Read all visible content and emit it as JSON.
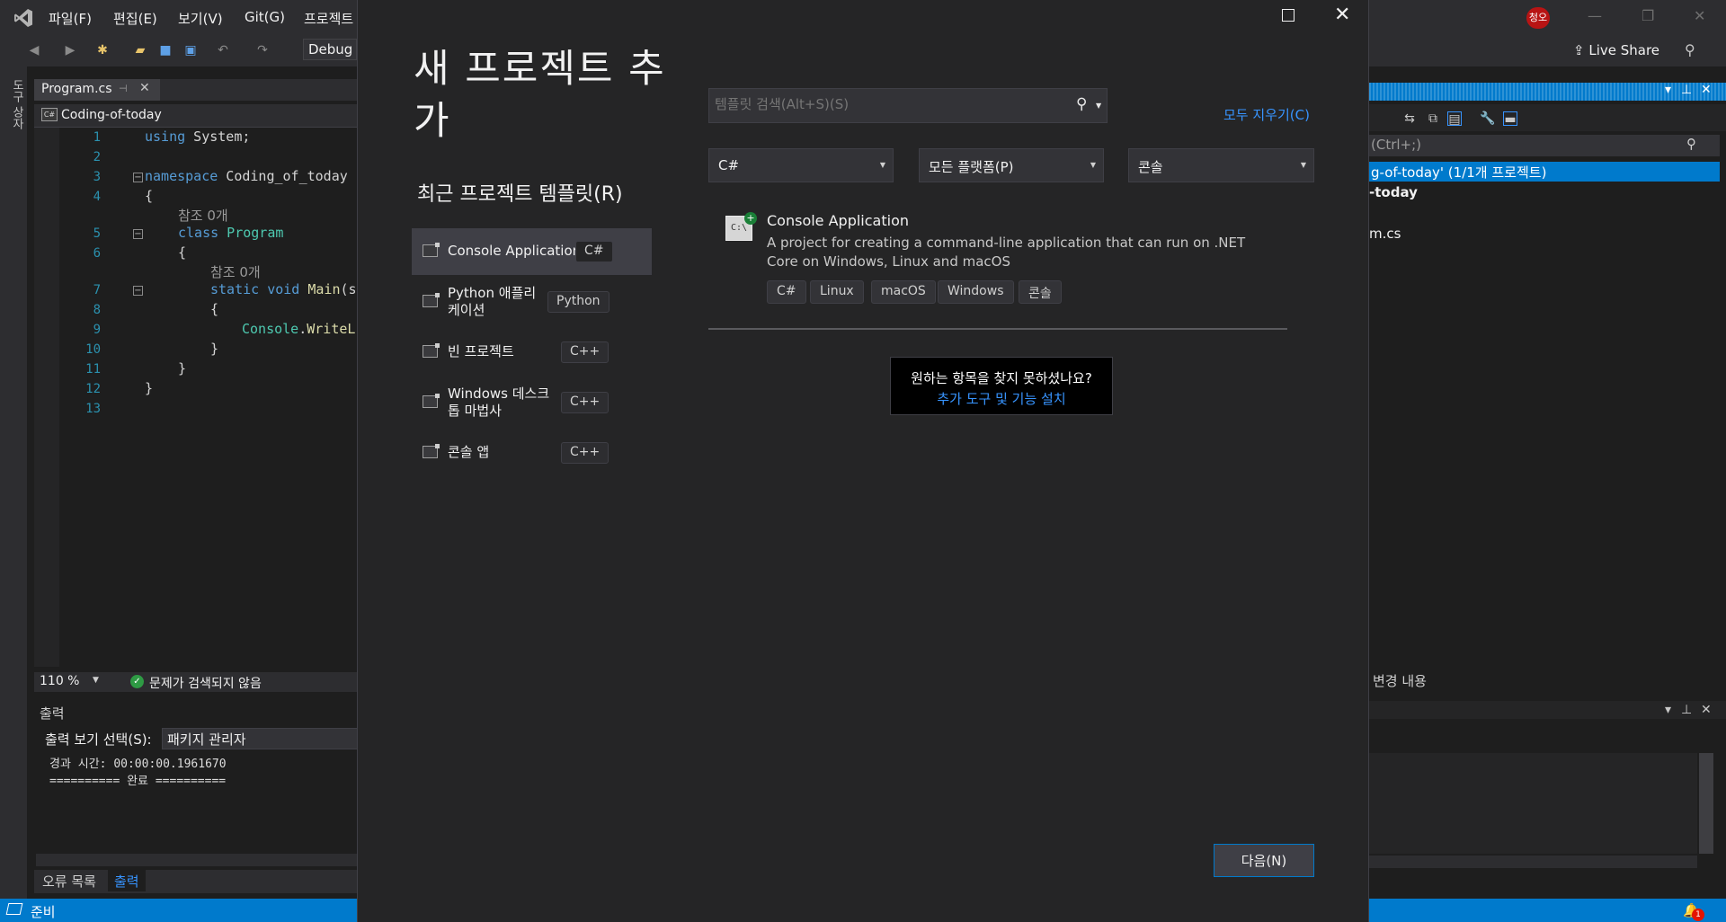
{
  "vs": {
    "menu": [
      "파일(F)",
      "편집(E)",
      "보기(V)",
      "Git(G)",
      "프로젝트"
    ],
    "toolbar": {
      "config": "Debug"
    },
    "user_initials": "청오",
    "live_share": "Live Share",
    "left_rail": "도구 상자",
    "editor": {
      "tab": "Program.cs",
      "nav_item": "Coding-of-today",
      "line_numbers": [
        "1",
        "2",
        "3",
        "4",
        "5",
        "6",
        "7",
        "8",
        "9",
        "10",
        "11",
        "12",
        "13"
      ],
      "code": {
        "l1_kw": "using",
        "l1_rest": " System;",
        "l3_kw": "namespace",
        "l3_rest": " Coding_of_today",
        "l4": "{",
        "ref_a": "참조 0개",
        "l5_kw": "class",
        "l5_ty": " Program",
        "l6": "{",
        "ref_b": "참조 0개",
        "l7_kw": "static void",
        "l7_fn": " Main",
        "l7_rest": "(s",
        "l8": "{",
        "l9_ty": "Console",
        "l9_rest": ".",
        "l9_fn": "WriteL",
        "l10": "}",
        "l11": "}",
        "l12": "}"
      },
      "zoom": "110 %",
      "issues": "문제가 검색되지 않음"
    },
    "output": {
      "title": "출력",
      "source_label": "출력 보기 선택(S):",
      "source_value": "패키지 관리자",
      "lines": [
        "경과 시간: 00:00:00.1961670",
        "========== 완료 =========="
      ],
      "tabs": {
        "error_list": "오류 목록",
        "output": "출력"
      }
    },
    "status": {
      "ready": "준비",
      "notifications": "1"
    },
    "solution_explorer": {
      "search_placeholder": "(Ctrl+;)",
      "selected": "g-of-today' (1/1개 프로젝트)",
      "project": "-today",
      "file": "m.cs",
      "changes": "변경 내용"
    }
  },
  "dialog": {
    "title": "새 프로젝트 추가",
    "recent_heading": "최근 프로젝트 템플릿(R)",
    "recent": [
      {
        "name": "Console Application",
        "lang": "C#"
      },
      {
        "name": "Python 애플리케이션",
        "lang": "Python"
      },
      {
        "name": "빈 프로젝트",
        "lang": "C++"
      },
      {
        "name": "Windows 데스크톱 마법사",
        "lang": "C++"
      },
      {
        "name": "콘솔 앱",
        "lang": "C++"
      }
    ],
    "search_placeholder": "템플릿 검색(Alt+S)(S)",
    "clear_all": "모두 지우기(C)",
    "filters": {
      "language": "C#",
      "platform": "모든 플랫폼(P)",
      "project_type": "콘솔"
    },
    "template": {
      "icon_text": "C:\\",
      "name": "Console Application",
      "description": "A project for creating a command-line application that can run on .NET Core on Windows, Linux and macOS",
      "tags": [
        "C#",
        "Linux",
        "macOS",
        "Windows",
        "콘솔"
      ]
    },
    "not_found": {
      "question": "원하는 항목을 찾지 못하셨나요?",
      "link": "추가 도구 및 기능 설치"
    },
    "next_button": "다음(N)"
  }
}
